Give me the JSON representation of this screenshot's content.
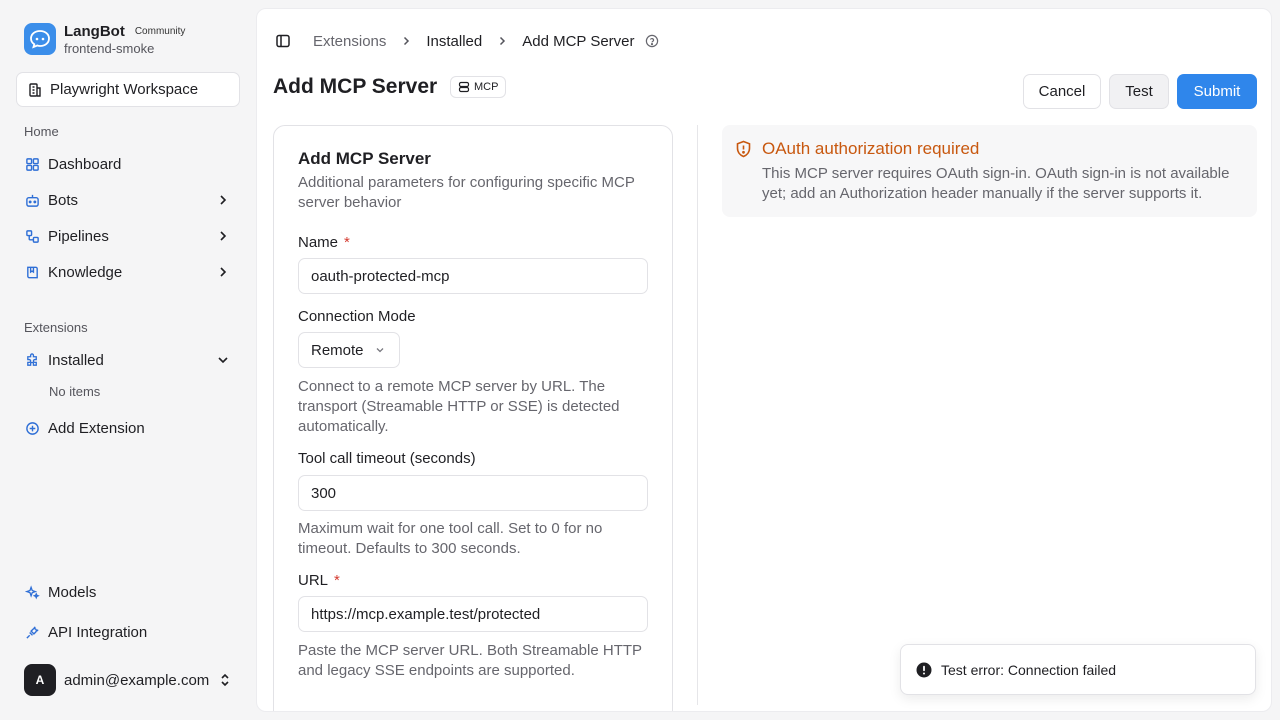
{
  "brand": {
    "name": "LangBot",
    "badge": "Community",
    "subtitle": "frontend-smoke",
    "logo_color": "#3b8eea"
  },
  "workspace": {
    "label": "Playwright Workspace"
  },
  "sidebar": {
    "home_section": "Home",
    "home_items": [
      {
        "label": "Dashboard",
        "icon": "dashboard-icon"
      },
      {
        "label": "Bots",
        "icon": "bot-icon"
      },
      {
        "label": "Pipelines",
        "icon": "pipeline-icon"
      },
      {
        "label": "Knowledge",
        "icon": "book-icon"
      }
    ],
    "extensions_section": "Extensions",
    "installed_label": "Installed",
    "no_items": "No items",
    "add_extension_label": "Add Extension",
    "models_label": "Models",
    "api_label": "API Integration"
  },
  "user": {
    "avatar_letter": "A",
    "email": "admin@example.com"
  },
  "breadcrumb": {
    "items": [
      "Extensions",
      "Installed",
      "Add MCP Server"
    ]
  },
  "page": {
    "title": "Add MCP Server",
    "chip": "MCP",
    "cancel_label": "Cancel",
    "test_label": "Test",
    "submit_label": "Submit",
    "accent_color": "#2f86eb"
  },
  "form": {
    "title": "Add MCP Server",
    "description": "Additional parameters for configuring specific MCP server behavior",
    "name_label": "Name",
    "name_value": "oauth-protected-mcp",
    "mode_label": "Connection Mode",
    "mode_value": "Remote",
    "mode_help": "Connect to a remote MCP server by URL. The transport (Streamable HTTP or SSE) is detected automatically.",
    "timeout_label": "Tool call timeout (seconds)",
    "timeout_value": "300",
    "timeout_help": "Maximum wait for one tool call. Set to 0 for no timeout. Defaults to 300 seconds.",
    "url_label": "URL",
    "url_value": "https://mcp.example.test/protected",
    "url_help": "Paste the MCP server URL. Both Streamable HTTP and legacy SSE endpoints are supported.",
    "required_marker": "*"
  },
  "alert": {
    "title": "OAuth authorization required",
    "body": "This MCP server requires OAuth sign-in. OAuth sign-in is not available yet; add an Authorization header manually if the server supports it.",
    "color": "#c8580f"
  },
  "toast": {
    "text": "Test error: Connection failed"
  }
}
